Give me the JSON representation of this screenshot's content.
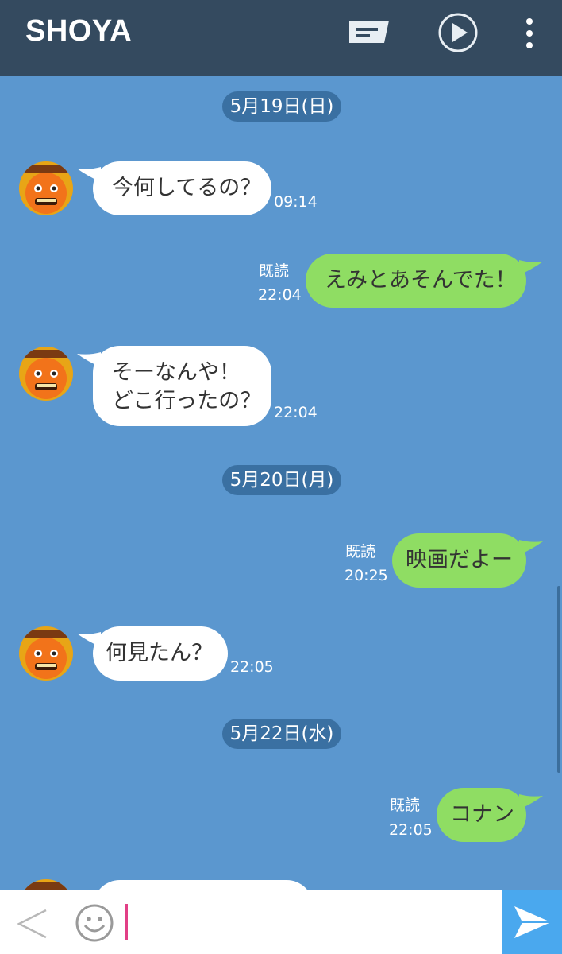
{
  "header": {
    "title": "SHOYA",
    "icons": [
      "notes-icon",
      "play-icon",
      "more-vertical-icon"
    ]
  },
  "chat": {
    "dates": [
      "5月19日(日)",
      "5月20日(月)",
      "5月22日(水)"
    ],
    "messages": [
      {
        "side": "in",
        "text": "今何してるの？",
        "time": "09:14"
      },
      {
        "side": "out",
        "text": "えみとあそんでた！",
        "time": "22:04",
        "read": "既読"
      },
      {
        "side": "in",
        "text": "そーなんや！\nどこ行ったの？",
        "time": "22:04"
      },
      {
        "side": "out",
        "text": "映画だよー",
        "time": "20:25",
        "read": "既読"
      },
      {
        "side": "in",
        "text": "何見たん？",
        "time": "22:05"
      },
      {
        "side": "out",
        "text": "コナン",
        "time": "22:05",
        "read": "既読"
      }
    ]
  },
  "input": {
    "icons": [
      "back-icon",
      "emoji-icon",
      "send-icon"
    ],
    "value": ""
  },
  "colors": {
    "header_bg": "#344a5f",
    "chat_bg": "#5b97cf",
    "date_pill": "#3a70a2",
    "bubble_in": "#ffffff",
    "bubble_out": "#8fdd63",
    "send_button": "#4aa8ee",
    "cursor": "#e23f86"
  }
}
